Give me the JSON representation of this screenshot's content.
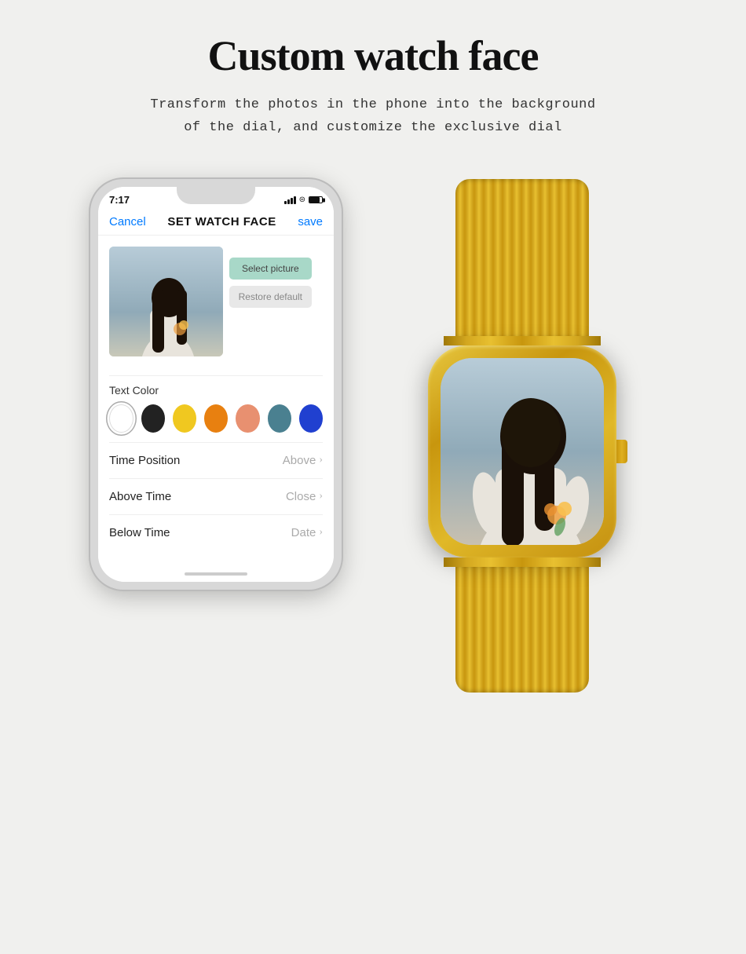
{
  "header": {
    "title": "Custom watch face",
    "subtitle_line1": "Transform the photos in the phone into the background",
    "subtitle_line2": "of the dial, and customize the exclusive dial"
  },
  "phone": {
    "time": "7:17",
    "screen_title": "SET WATCH FACE",
    "cancel_label": "Cancel",
    "save_label": "save",
    "select_picture_btn": "Select picture",
    "restore_default_btn": "Restore default",
    "text_color_label": "Text Color",
    "colors": [
      {
        "name": "white",
        "hex": "#ffffff",
        "selected": true
      },
      {
        "name": "black",
        "hex": "#222222",
        "selected": false
      },
      {
        "name": "yellow",
        "hex": "#f0c820",
        "selected": false
      },
      {
        "name": "orange",
        "hex": "#e88010",
        "selected": false
      },
      {
        "name": "peach",
        "hex": "#e89070",
        "selected": false
      },
      {
        "name": "teal",
        "hex": "#4a8090",
        "selected": false
      },
      {
        "name": "blue",
        "hex": "#2040d0",
        "selected": false
      }
    ],
    "settings": [
      {
        "label": "Time Position",
        "value": "Above"
      },
      {
        "label": "Above Time",
        "value": "Close"
      },
      {
        "label": "Below Time",
        "value": "Date"
      }
    ]
  },
  "watch": {
    "band_color": "#d4a017",
    "case_color": "#d4a017"
  }
}
